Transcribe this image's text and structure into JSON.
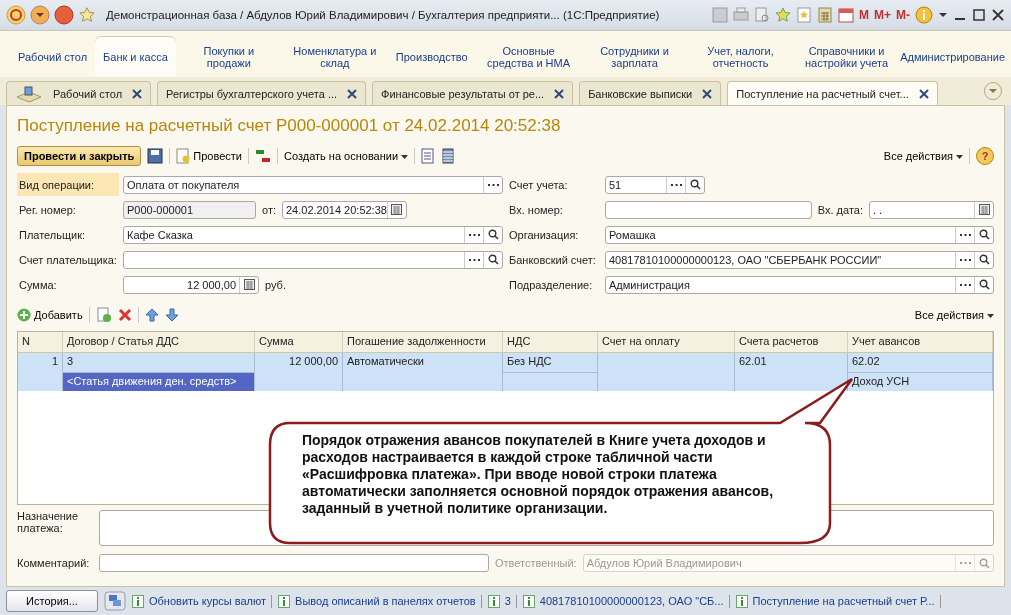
{
  "window": {
    "title": "Демонстрационная база / Абдулов Юрий Владимирович / Бухгалтерия предприяти...  (1С:Предприятие)",
    "memory_buttons": [
      "M",
      "M+",
      "M-"
    ]
  },
  "sections": [
    {
      "label": "Рабочий стол",
      "selected": false
    },
    {
      "label": "Банк и касса",
      "selected": true
    },
    {
      "label": "Покупки и продажи",
      "selected": false
    },
    {
      "label": "Номенклатура и склад",
      "selected": false
    },
    {
      "label": "Производство",
      "selected": false
    },
    {
      "label": "Основные средства и НМА",
      "selected": false
    },
    {
      "label": "Сотрудники и зарплата",
      "selected": false
    },
    {
      "label": "Учет, налоги, отчетность",
      "selected": false
    },
    {
      "label": "Справочники и настройки учета",
      "selected": false
    },
    {
      "label": "Администрирование",
      "selected": false
    }
  ],
  "open_tabs": [
    {
      "label": "Рабочий стол",
      "selected": false,
      "kind": "home"
    },
    {
      "label": "Регистры бухгалтерского учета ...",
      "selected": false,
      "kind": "doc"
    },
    {
      "label": "Финансовые результаты от ре...",
      "selected": false,
      "kind": "doc"
    },
    {
      "label": "Банковские выписки",
      "selected": false,
      "kind": "doc"
    },
    {
      "label": "Поступление на расчетный счет...",
      "selected": true,
      "kind": "doc"
    }
  ],
  "form": {
    "title": "Поступление на расчетный счет Р000-000001 от 24.02.2014 20:52:38",
    "toolbar": {
      "primary": "Провести и закрыть",
      "post": "Провести",
      "create_based": "Создать на основании",
      "all_actions": "Все действия",
      "help": "?"
    },
    "rows": [
      {
        "left": [
          {
            "kind": "label",
            "text": "Вид операции:",
            "focused": true
          },
          {
            "kind": "choice-field",
            "value": "Оплата от покупателя"
          }
        ],
        "right": [
          {
            "kind": "label",
            "text": "Счет учета:",
            "focused": false
          },
          {
            "kind": "short-field",
            "value": "51"
          }
        ]
      },
      {
        "left": [
          {
            "kind": "label",
            "text": "Рег. номер:",
            "focused": false
          },
          {
            "kind": "readonly-field",
            "value": "Р000-000001"
          },
          {
            "kind": "unit",
            "text": "от:"
          },
          {
            "kind": "date-field",
            "value": "24.02.2014 20:52:38"
          }
        ],
        "right": [
          {
            "kind": "label",
            "text": "Вх. номер:",
            "focused": false
          },
          {
            "kind": "text-field"
          },
          {
            "kind": "unit",
            "text": "Вх. дата:"
          },
          {
            "kind": "date-field",
            "value": " .  ."
          }
        ]
      },
      {
        "left": [
          {
            "kind": "label",
            "text": "Плательщик:",
            "focused": false
          },
          {
            "kind": "select-field",
            "value": "Кафе Сказка"
          }
        ],
        "right": [
          {
            "kind": "label",
            "text": "Организация:",
            "focused": false
          },
          {
            "kind": "select-field",
            "value": "Ромашка"
          }
        ]
      },
      {
        "left": [
          {
            "kind": "label",
            "text": "Счет плательщика:",
            "focused": false
          },
          {
            "kind": "select-field"
          }
        ],
        "right": [
          {
            "kind": "label",
            "text": "Банковский счет:",
            "focused": false
          },
          {
            "kind": "select-field",
            "value": "40817810100000000123, ОАО \"СБЕРБАНК РОССИИ\""
          }
        ]
      },
      {
        "left": [
          {
            "kind": "label",
            "text": "Сумма:",
            "focused": false
          },
          {
            "kind": "number-field",
            "value": "12 000,00"
          },
          {
            "kind": "unit",
            "text": "руб."
          }
        ],
        "right": [
          {
            "kind": "label",
            "text": "Подразделение:",
            "focused": false
          },
          {
            "kind": "select-field",
            "value": "Администрация"
          }
        ]
      }
    ],
    "table_toolbar": {
      "add": "Добавить",
      "all_actions": "Все действия"
    },
    "table": {
      "columns": [
        "N",
        "Договор / Статья ДДС",
        "Сумма",
        "Погашение задолженности",
        "НДС",
        "Счет на оплату",
        "Счета расчетов",
        "Учет авансов"
      ],
      "rows": [
        {
          "cells": [
            "1",
            "3",
            "12 000,00",
            "Автоматически",
            "Без НДС",
            null,
            "62.01",
            "62.02"
          ],
          "sub_cells": [
            null,
            {
              "text": "<Статья движения ден. средств>",
              "selected": true
            },
            null,
            null,
            {
              "selected": false
            },
            null,
            null,
            {
              "text": "Доход УСН",
              "selected": false
            }
          ]
        }
      ]
    },
    "purpose": {
      "label": "Назначение платежа:"
    },
    "comment": {
      "label": "Комментарий:",
      "responsible_label": "Ответственный:",
      "responsible": "Абдулов Юрий Владимирович"
    }
  },
  "callout": {
    "text": "Порядок отражения авансов покупателей в Книге учета доходов и расходов настраивается в каждой строке табличной части «Расшифровка платежа». При вводе новой строки платежа автоматически заполняется основной порядок отражения авансов, заданный в учетной политике организации."
  },
  "taskbar": {
    "history": "История...",
    "items": [
      "Обновить курсы валют",
      "Вывод описаний в панелях отчетов",
      "3",
      "40817810100000000123, ОАО \"СБ...",
      "Поступление на расчетный счет Р..."
    ]
  }
}
